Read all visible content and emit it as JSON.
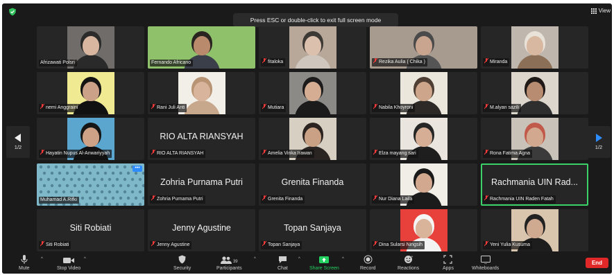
{
  "window": {
    "banner": "Press ESC or double-click to exit full screen mode",
    "view_label": "View",
    "security_icon": "shield-icon",
    "page_left": "1/2",
    "page_right": "1/2"
  },
  "colors": {
    "accent_share": "#23d160",
    "active_speaker": "#3bd26a",
    "end": "#e02828",
    "muted": "#ff3b3b"
  },
  "participants": [
    {
      "name": "Afrizawati Polsri",
      "muted": false,
      "video": true,
      "skin": "#d8b6a0",
      "garment": "#2a2a2a",
      "bg": "#6f6c69",
      "hijab": "#2b2b2b"
    },
    {
      "name": "Fernando Africano",
      "muted": false,
      "video": true,
      "wide": true,
      "skin": "#b98a6c",
      "garment": "#3a3f4a",
      "bg": "#8fc16a",
      "hijab": "#2a2420"
    },
    {
      "name": "fitaloka",
      "muted": true,
      "video": true,
      "skin": "#dcc0ae",
      "garment": "#cfc7bd",
      "bg": "#b7a899",
      "hijab": "#3d3935"
    },
    {
      "name": "Rezika Aulia ( Chika )",
      "muted": true,
      "video": true,
      "wide": true,
      "skin": "#c9a48f",
      "garment": "#555",
      "bg": "#a79a8f",
      "hijab": "#4a4a4a"
    },
    {
      "name": "Miranda",
      "muted": true,
      "video": true,
      "skin": "#d9b8a2",
      "garment": "#8b6f57",
      "bg": "#bfb7ae",
      "hijab": "#e8e2d8"
    },
    {
      "name": "nemi Anggraini",
      "muted": true,
      "video": true,
      "skin": "#cba288",
      "garment": "#111",
      "bg": "#f0ea92",
      "hijab": "#141414"
    },
    {
      "name": "Rani Juli Anti",
      "muted": true,
      "video": true,
      "skin": "#d8b49d",
      "garment": "#c7a88c",
      "bg": "#f2efe9",
      "hijab": "#b89474"
    },
    {
      "name": "Mutiara",
      "muted": true,
      "video": true,
      "skin": "#d4ad93",
      "garment": "#1b1b1b",
      "bg": "#8c8a86",
      "hijab": "#1c1c1c"
    },
    {
      "name": "Nabila Khoyroni",
      "muted": true,
      "video": true,
      "skin": "#cda58a",
      "garment": "#2d2926",
      "bg": "#ece7dc",
      "hijab": "#4e3e33"
    },
    {
      "name": "M.alyan sazili",
      "muted": true,
      "video": true,
      "skin": "#b88c70",
      "garment": "#2e2e2e",
      "bg": "#ddd6cc",
      "hijab": "#1f1a17"
    },
    {
      "name": "Hayatin Nupus Al-Anwariyyah",
      "muted": true,
      "video": true,
      "skin": "#cda286",
      "garment": "#111",
      "bg": "#5aa6cf",
      "hijab": "#161616"
    },
    {
      "name": "RIO ALTA RIANSYAH",
      "muted": true,
      "video": false,
      "display": "RIO ALTA RIANSYAH"
    },
    {
      "name": "Amelia Vinka Irawan",
      "muted": true,
      "video": true,
      "skin": "#caa185",
      "garment": "#2a2523",
      "bg": "#d7d0c2",
      "hijab": "#2b2320"
    },
    {
      "name": "Elza mayang sari",
      "muted": true,
      "video": true,
      "skin": "#d5ae95",
      "garment": "#1e1e1e",
      "bg": "#eae6df",
      "hijab": "#262626"
    },
    {
      "name": "Rona Fatima Agna",
      "muted": true,
      "video": true,
      "skin": "#d2a98e",
      "garment": "#3b3b3b",
      "bg": "#c9c2b8",
      "hijab": "#c15a4a"
    },
    {
      "name": "Muhamad A.Rifki",
      "muted": false,
      "video": true,
      "wide": true,
      "pattern": true,
      "bg": "#7fb8c9"
    },
    {
      "name": "Zohria Purnama Putri",
      "muted": true,
      "video": false,
      "display": "Zohria Purnama Putri"
    },
    {
      "name": "Grenita Finanda",
      "muted": true,
      "video": false,
      "display": "Grenita Finanda"
    },
    {
      "name": "Nur Diana Laila",
      "muted": true,
      "video": true,
      "skin": "#d2a98f",
      "garment": "#1b1b1b",
      "bg": "#f1eee8",
      "hijab": "#1a1a1a"
    },
    {
      "name": "Rachmania UIN Raden Fatah",
      "muted": true,
      "video": false,
      "display": "Rachmania UIN Rad...",
      "active": true
    },
    {
      "name": "Siti Robiati",
      "muted": true,
      "video": false,
      "display": "Siti Robiati"
    },
    {
      "name": "Jenny Agustine",
      "muted": true,
      "video": false,
      "display": "Jenny Agustine"
    },
    {
      "name": "Topan Sanjaya",
      "muted": true,
      "video": false,
      "display": "Topan Sanjaya"
    },
    {
      "name": "Dina Sularsi Ningsih",
      "muted": true,
      "video": true,
      "skin": "#d9b39a",
      "garment": "#f3f3f3",
      "bg": "#e8403a",
      "hijab": "#f5f5f5"
    },
    {
      "name": "Yeni Yulia Kusuma",
      "muted": true,
      "video": true,
      "skin": "#d0aa90",
      "garment": "#1d1d1d",
      "bg": "#d9c5ad",
      "hijab": "#222"
    }
  ],
  "toolbar": {
    "mute": "Mute",
    "stop_video": "Stop Video",
    "security": "Security",
    "participants": "Participants",
    "participants_count": "39",
    "chat": "Chat",
    "share_screen": "Share Screen",
    "record": "Record",
    "reactions": "Reactions",
    "apps": "Apps",
    "whiteboards": "Whiteboards",
    "end": "End"
  }
}
